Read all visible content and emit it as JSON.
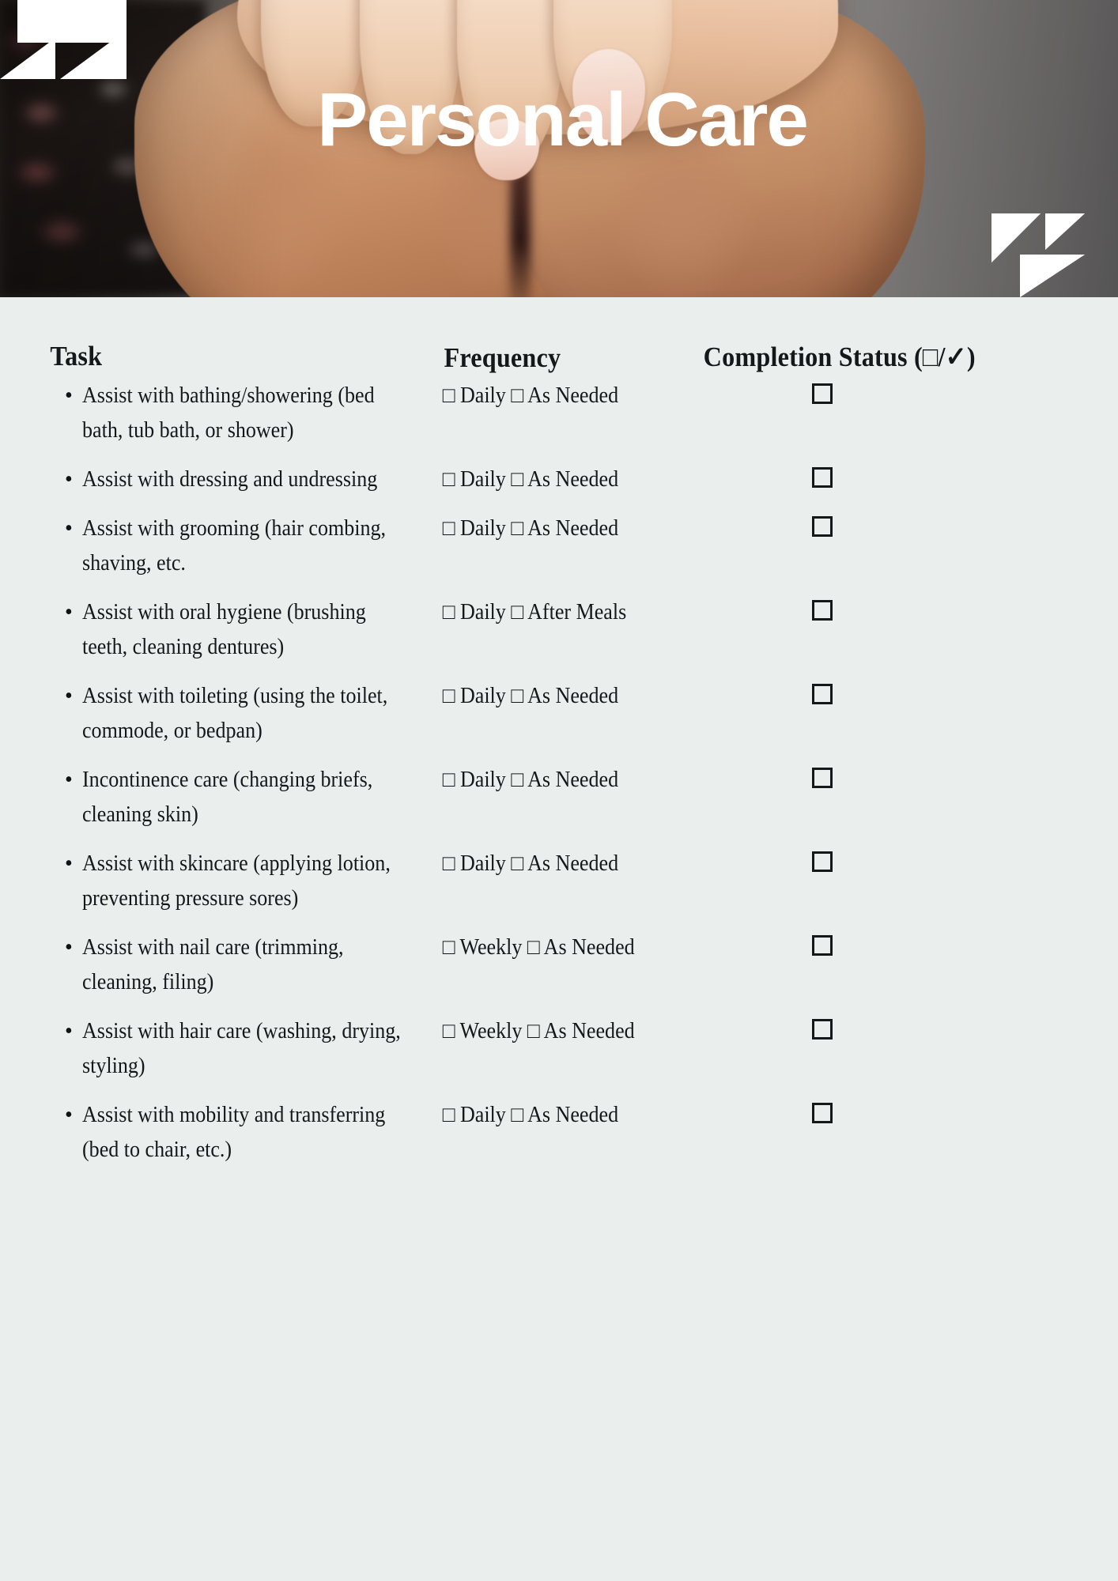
{
  "header": {
    "title": "Personal Care",
    "logo_top_left": "brand-mark",
    "logo_bottom_right": "brand-mark"
  },
  "table": {
    "columns": {
      "task": "Task",
      "frequency": "Frequency",
      "status": "Completion Status (□/✓)"
    },
    "rows": [
      {
        "task": "Assist with bathing/showering (bed bath, tub bath, or shower)",
        "frequency": "□ Daily □ As Needed",
        "status": "unchecked"
      },
      {
        "task": "Assist with dressing and undressing",
        "frequency": "□ Daily □ As Needed",
        "status": "unchecked"
      },
      {
        "task": "Assist with grooming (hair combing, shaving, etc.",
        "frequency": "□ Daily □ As Needed",
        "status": "unchecked"
      },
      {
        "task": "Assist with oral hygiene (brushing teeth, cleaning dentures)",
        "frequency": "□ Daily □ After Meals",
        "status": "unchecked"
      },
      {
        "task": "Assist with toileting (using the toilet, commode, or bedpan)",
        "frequency": "□ Daily □ As Needed",
        "status": "unchecked"
      },
      {
        "task": "Incontinence care (changing briefs, cleaning skin)",
        "frequency": "□ Daily □ As Needed",
        "status": "unchecked"
      },
      {
        "task": "Assist with skincare (applying lotion, preventing pressure sores)",
        "frequency": "□ Daily □ As Needed",
        "status": "unchecked"
      },
      {
        "task": "Assist with nail care (trimming, cleaning, filing)",
        "frequency": "□ Weekly □ As Needed",
        "status": "unchecked"
      },
      {
        "task": "Assist with hair care (washing, drying, styling)",
        "frequency": "□ Weekly □ As Needed",
        "status": "unchecked"
      },
      {
        "task": "Assist with mobility and transferring (bed to chair, etc.)",
        "frequency": "□ Daily □ As Needed",
        "status": "unchecked"
      }
    ],
    "bullet_glyph": "•"
  },
  "colors": {
    "page_background": "#eaeeed",
    "text": "#14181a",
    "title": "#ffffff",
    "mark": "#ffffff"
  }
}
